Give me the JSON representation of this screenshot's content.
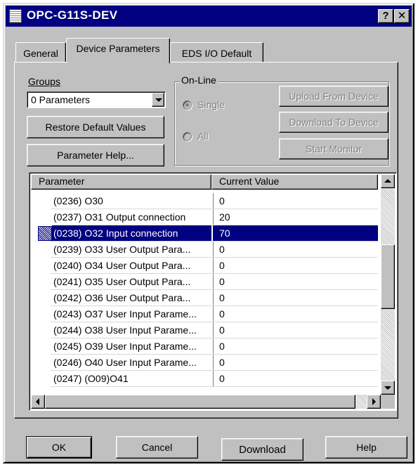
{
  "window": {
    "title": "OPC-G11S-DEV",
    "help_glyph": "?",
    "close_glyph": "✕"
  },
  "tabs": [
    {
      "label": "General"
    },
    {
      "label": "Device Parameters",
      "active": true
    },
    {
      "label": "EDS I/O Default"
    }
  ],
  "groups": {
    "label": "Groups",
    "selected": "0 Parameters"
  },
  "buttons": {
    "restore_defaults": "Restore Default Values",
    "parameter_help": "Parameter Help...",
    "upload": "Upload From Device",
    "download_device": "Download To Device",
    "start_monitor": "Start Monitor"
  },
  "online": {
    "label": "On-Line",
    "single": "Single",
    "all": "All"
  },
  "table": {
    "columns": [
      "Parameter",
      "Current Value"
    ],
    "rows": [
      {
        "param": "(0236) O30",
        "value": "0"
      },
      {
        "param": "(0237) O31  Output connection",
        "value": "20"
      },
      {
        "param": "(0238) O32  Input connection",
        "value": "70",
        "selected": true
      },
      {
        "param": "(0239) O33 User Output Para...",
        "value": "0"
      },
      {
        "param": "(0240) O34 User Output Para...",
        "value": "0"
      },
      {
        "param": "(0241) O35 User Output Para...",
        "value": "0"
      },
      {
        "param": "(0242) O36 User Output Para...",
        "value": "0"
      },
      {
        "param": "(0243) O37 User Input Parame...",
        "value": "0"
      },
      {
        "param": "(0244) O38 User Input Parame...",
        "value": "0"
      },
      {
        "param": "(0245) O39 User Input Parame...",
        "value": "0"
      },
      {
        "param": "(0246) O40 User Input Parame...",
        "value": "0"
      },
      {
        "param": "(0247) (O09)O41",
        "value": "0"
      }
    ]
  },
  "footer": {
    "ok": "OK",
    "cancel": "Cancel",
    "download": "Download",
    "help": "Help"
  },
  "colors": {
    "titlebar": "#000080",
    "selection": "#000080",
    "face": "#c0c0c0"
  }
}
